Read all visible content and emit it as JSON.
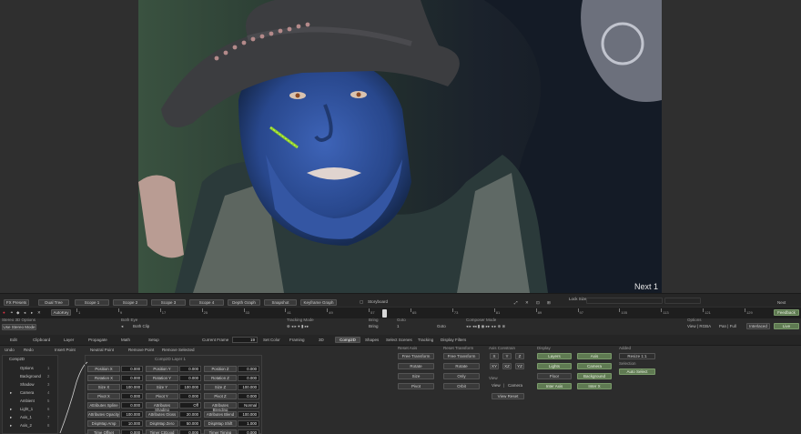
{
  "viewer": {
    "overlay_label": "Next 1"
  },
  "top_tabs": [
    "FX Presets",
    "Dual Tree",
    "Scope 1",
    "Scope 2",
    "Scope 3",
    "Scope 4",
    "Depth Graph",
    "Snapshot",
    "Keyframe Graph",
    "Storyboard"
  ],
  "top_right": {
    "lock": "Lock Size",
    "next": "Next",
    "feedback": "Feedback",
    "live": "Live"
  },
  "timeline": {
    "autokey": "AutoKey",
    "numbers": [
      "1",
      "9",
      "17",
      "25",
      "33",
      "41",
      "49",
      "57",
      "65",
      "73",
      "81",
      "89",
      "97",
      "105",
      "113",
      "121",
      "129"
    ]
  },
  "controls": {
    "stereo_3d_options": "Stereo 3D Options",
    "use_stereo_mode": "Use Stereo Mode",
    "both_eye": "Both Eye",
    "both_clip": "Both Clip",
    "tracking_mode": "Tracking Mode",
    "bring": "Bring",
    "bring_val": "Bring",
    "goto": "Goto",
    "goto_val": "Goto",
    "goto_num": "1",
    "composer_mode": "Composer Mode",
    "options": "Options",
    "view_rgba": "View | RGBA",
    "pan_full": "Pan | Full",
    "interlaced": "Interlaced",
    "live": "Live"
  },
  "node_tabs": [
    "Edit",
    "Clipboard",
    "Layer",
    "Propagate",
    "Math",
    "Setup"
  ],
  "current_frame_label": "Current Frame",
  "current_frame_value": "19",
  "mode_tabs": [
    "Set Color",
    "Framing",
    "3D",
    "Comp2D",
    "Shapes",
    "Select Scenes",
    "Tracking",
    "Display Filters"
  ],
  "left_toolbar": [
    "Undo",
    "Redo",
    "Insert Point",
    "Neutral Point",
    "Remove Point",
    "Remove Selected"
  ],
  "tree": {
    "root": "Comp2D",
    "items": [
      {
        "label": "Options",
        "num": "1"
      },
      {
        "label": "Background",
        "num": "2"
      },
      {
        "label": "Shadow",
        "num": "3"
      },
      {
        "label": "Camera",
        "num": "4"
      },
      {
        "label": "Ambient",
        "num": "5"
      },
      {
        "label": "Light_1",
        "num": "6"
      },
      {
        "label": "Axis_1",
        "num": "7"
      },
      {
        "label": "Axis_2",
        "num": "8"
      }
    ]
  },
  "params": {
    "group_title": "Comp2D Layer 1",
    "rows": [
      [
        [
          "Position X",
          "0.000"
        ],
        [
          "Position Y",
          "0.000"
        ],
        [
          "Position Z",
          "0.000"
        ]
      ],
      [
        [
          "Rotation X",
          "0.000"
        ],
        [
          "Rotation Y",
          "0.000"
        ],
        [
          "Rotation Z",
          "0.000"
        ]
      ],
      [
        [
          "Size X",
          "100.000"
        ],
        [
          "Size Y",
          "100.000"
        ],
        [
          "Size Z",
          "100.000"
        ]
      ],
      [
        [
          "Pivot X",
          "0.000"
        ],
        [
          "Pivot Y",
          "0.000"
        ],
        [
          "Pivot Z",
          "0.000"
        ]
      ],
      [
        [
          "Attributes Spline",
          "0.000"
        ],
        [
          "Attributes Shading",
          "Off"
        ],
        [
          "Attributes Blending",
          "Normal"
        ]
      ],
      [
        [
          "Attributes Opacity",
          "100.000"
        ],
        [
          "Attributes Gloss",
          "20.000"
        ],
        [
          "Attributes Blend",
          "100.000"
        ]
      ],
      [
        [
          "DispMap Amp",
          "10.000"
        ],
        [
          "DispMap Zero",
          "50.000"
        ],
        [
          "DispMap Shift",
          "1.000"
        ]
      ],
      [
        [
          "Time Offset",
          "0.000"
        ],
        [
          "Timer CtGood",
          "0.000"
        ],
        [
          "Timer Timing",
          "0.000"
        ]
      ]
    ]
  },
  "right_panel": {
    "reset_axis_title": "Reset Axis",
    "reset_axis": [
      "Free Transform",
      "Rotate",
      "Size",
      "Pivot"
    ],
    "reset_transform_title": "Reset Transform",
    "reset_transform": [
      "Free Transform",
      "Rotate",
      "Only",
      "Orbit"
    ],
    "axis_constrain_title": "Axis Constrain",
    "axis_constrain": [
      "X",
      "Y",
      "Z",
      "XY",
      "XZ",
      "YZ"
    ],
    "view_title": "View",
    "view": [
      "View",
      "Camera"
    ],
    "view_reset": "View Reset",
    "display_title": "Display",
    "display": [
      "Layers",
      "Axis",
      "Lights",
      "Camera",
      "Floor",
      "Background",
      "Inter Axis",
      "Inter X"
    ],
    "added_title": "Added",
    "added_btn": "Resize 1:1",
    "selection_title": "Selection",
    "selection_btn": "Auto Select"
  }
}
